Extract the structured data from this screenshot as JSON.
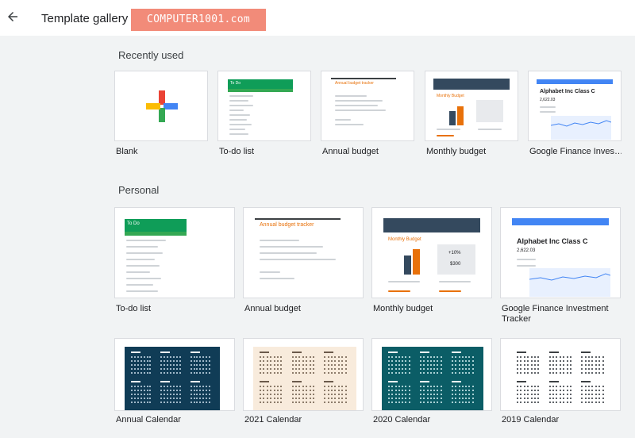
{
  "header": {
    "title": "Template gallery",
    "watermark": "COMPUTER1001.com"
  },
  "sections": [
    {
      "title": "Recently used",
      "templates": [
        {
          "label": "Blank",
          "icon": "plus-icon"
        },
        {
          "label": "To-do list",
          "thumb_title": "To Do"
        },
        {
          "label": "Annual budget",
          "thumb_title": "Annual budget tracker"
        },
        {
          "label": "Monthly budget",
          "thumb_title": "Monthly Budget"
        },
        {
          "label": "Google Finance Inves…",
          "thumb_title": "Alphabet Inc Class C",
          "thumb_value": "2,622.03"
        }
      ]
    },
    {
      "title": "Personal",
      "templates": [
        {
          "label": "To-do list",
          "thumb_title": "To Do"
        },
        {
          "label": "Annual budget",
          "thumb_title": "Annual budget tracker"
        },
        {
          "label": "Monthly budget",
          "thumb_title": "Monthly Budget",
          "thumb_badge": "+10%",
          "thumb_amount": "$300"
        },
        {
          "label": "Google Finance Investment Tracker",
          "thumb_title": "Alphabet Inc Class C",
          "thumb_value": "2,622.03"
        },
        {
          "label": "Annual Calendar"
        },
        {
          "label": "2021 Calendar"
        },
        {
          "label": "2020 Calendar"
        },
        {
          "label": "2019 Calendar"
        }
      ]
    }
  ],
  "colors": {
    "green": "#0f9d58",
    "orange": "#e8710a",
    "navy": "#34495e",
    "blue": "#4285f4",
    "teal": "#0b5d66",
    "cream": "#f8ebdc",
    "plus": [
      "#4285f4",
      "#ea4335",
      "#fbbc04",
      "#34a853"
    ]
  }
}
